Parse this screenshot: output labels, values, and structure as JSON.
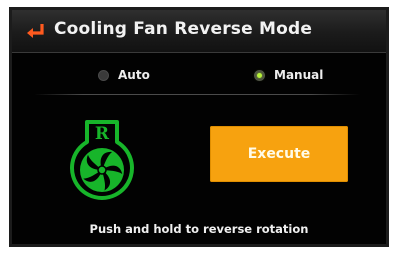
{
  "title": "Cooling Fan Reverse Mode",
  "modes": {
    "auto_label": "Auto",
    "manual_label": "Manual",
    "selected": "Manual"
  },
  "fan_badge_letter": "R",
  "execute_label": "Execute",
  "hint": "Push and hold to reverse rotation",
  "colors": {
    "accent_orange": "#f7a20f",
    "fan_green": "#17b52a",
    "radio_active": "#b6f23a",
    "back_arrow": "#ff5a1f"
  },
  "icons": [
    "back-arrow-icon",
    "reverse-fan-icon"
  ]
}
